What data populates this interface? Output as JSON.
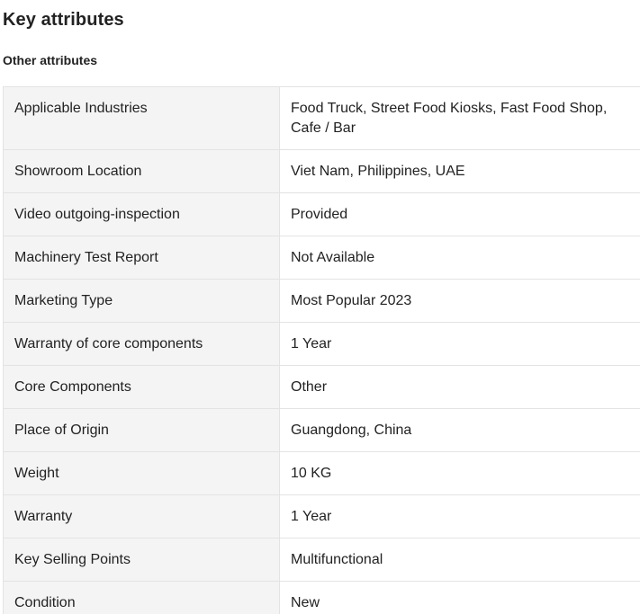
{
  "header": {
    "title": "Key attributes",
    "subtitle": "Other attributes"
  },
  "attributes": [
    {
      "label": "Applicable Industries",
      "value": "Food Truck, Street Food Kiosks, Fast Food Shop, Cafe / Bar"
    },
    {
      "label": "Showroom Location",
      "value": "Viet Nam, Philippines, UAE"
    },
    {
      "label": "Video outgoing-inspection",
      "value": "Provided"
    },
    {
      "label": "Machinery Test Report",
      "value": "Not Available"
    },
    {
      "label": "Marketing Type",
      "value": "Most Popular 2023"
    },
    {
      "label": "Warranty of core components",
      "value": "1 Year"
    },
    {
      "label": "Core Components",
      "value": "Other"
    },
    {
      "label": "Place of Origin",
      "value": "Guangdong, China"
    },
    {
      "label": "Weight",
      "value": "10 KG"
    },
    {
      "label": "Warranty",
      "value": "1 Year"
    },
    {
      "label": "Key Selling Points",
      "value": "Multifunctional"
    },
    {
      "label": "Condition",
      "value": "New"
    }
  ]
}
